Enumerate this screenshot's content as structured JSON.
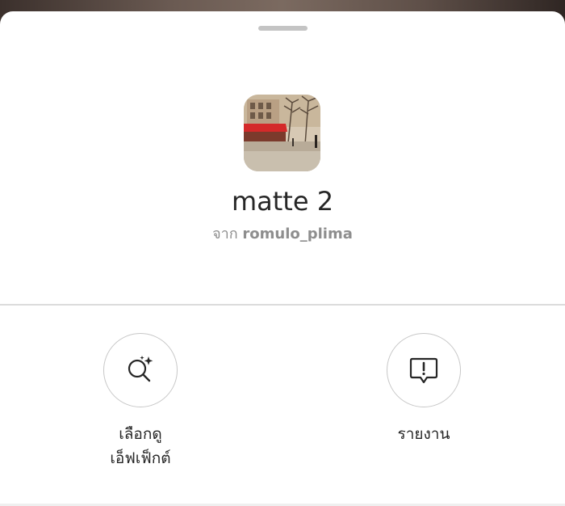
{
  "effect": {
    "name": "matte 2",
    "by_prefix": "จาก",
    "author": "romulo_plima"
  },
  "actions": [
    {
      "label": "เลือกดู\nเอ็ฟเฟ็กต์",
      "icon": "browse-effects-icon"
    },
    {
      "label": "รายงาน",
      "icon": "report-icon"
    }
  ],
  "colors": {
    "text": "#262626",
    "secondary": "#8e8e8e",
    "circle_border": "#c7c7c7",
    "divider": "#dbdbdb"
  }
}
